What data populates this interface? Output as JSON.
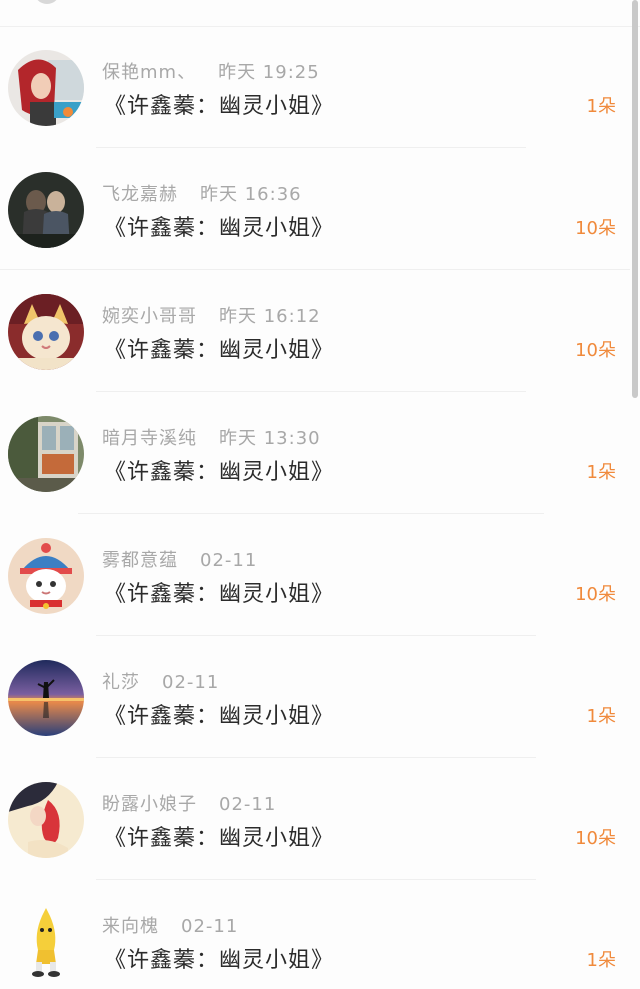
{
  "comments": [
    {
      "name": "保艳mm、",
      "time": "昨天 19:25",
      "title": "《许鑫蓁：幽灵小姐》",
      "count": "1朵",
      "avatar": "woman-red-hair-avatar"
    },
    {
      "name": "飞龙嘉赫",
      "time": "昨天 16:36",
      "title": "《许鑫蓁：幽灵小姐》",
      "count": "10朵",
      "avatar": "couple-dark-photo-avatar"
    },
    {
      "name": "婉奕小哥哥",
      "time": "昨天 16:12",
      "title": "《许鑫蓁：幽灵小姐》",
      "count": "10朵",
      "avatar": "cat-costume-avatar"
    },
    {
      "name": "暗月寺溪纯",
      "time": "昨天 13:30",
      "title": "《许鑫蓁：幽灵小姐》",
      "count": "1朵",
      "avatar": "window-scene-avatar"
    },
    {
      "name": "雾都意蕴",
      "time": "02-11",
      "title": "《许鑫蓁：幽灵小姐》",
      "count": "10朵",
      "avatar": "cat-blue-hat-avatar"
    },
    {
      "name": "礼莎",
      "time": "02-11",
      "title": "《许鑫蓁：幽灵小姐》",
      "count": "1朵",
      "avatar": "sunset-silhouette-avatar"
    },
    {
      "name": "盼露小娘子",
      "time": "02-11",
      "title": "《许鑫蓁：幽灵小姐》",
      "count": "10朵",
      "avatar": "illustrated-girl-avatar"
    },
    {
      "name": "来向槐",
      "time": "02-11",
      "title": "《许鑫蓁：幽灵小姐》",
      "count": "1朵",
      "avatar": "banana-figure-avatar"
    }
  ],
  "colors": {
    "count": "#f08a3c",
    "meta": "#a8a8a8",
    "title": "#2b2b2b",
    "divider": "#efefef"
  }
}
